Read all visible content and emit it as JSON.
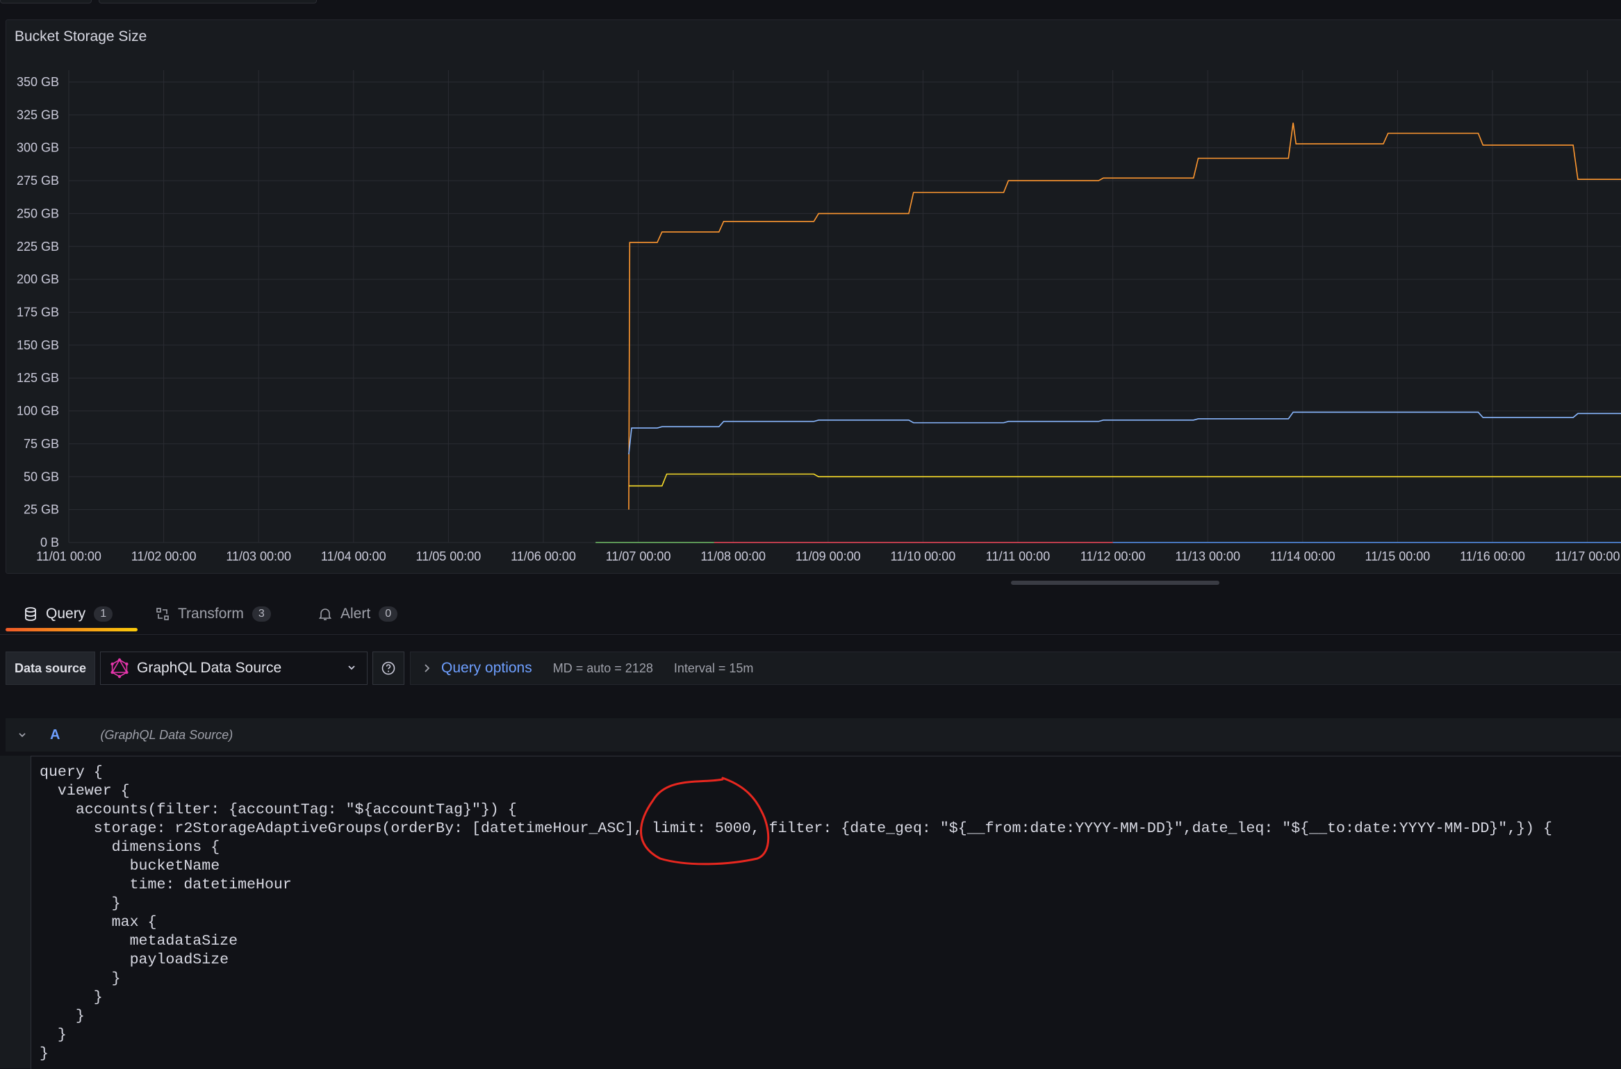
{
  "panel": {
    "title": "Bucket Storage Size"
  },
  "chart_data": {
    "type": "line",
    "title": "Bucket Storage Size",
    "y_ticks": [
      "0 B",
      "25 GB",
      "50 GB",
      "75 GB",
      "100 GB",
      "125 GB",
      "150 GB",
      "175 GB",
      "200 GB",
      "225 GB",
      "250 GB",
      "275 GB",
      "300 GB",
      "325 GB",
      "350 GB"
    ],
    "x_ticks": [
      "11/01 00:00",
      "11/02 00:00",
      "11/03 00:00",
      "11/04 00:00",
      "11/05 00:00",
      "11/06 00:00",
      "11/07 00:00",
      "11/08 00:00",
      "11/09 00:00",
      "11/10 00:00",
      "11/11 00:00",
      "11/12 00:00",
      "11/13 00:00",
      "11/14 00:00",
      "11/15 00:00",
      "11/16 00:00",
      "11/17 00:00"
    ],
    "ylim": [
      0,
      350
    ],
    "grid": true,
    "series": [
      {
        "color": "#ff9830",
        "points": [
          [
            5.9,
            25
          ],
          [
            5.91,
            228
          ],
          [
            6.2,
            228
          ],
          [
            6.25,
            236
          ],
          [
            6.85,
            236
          ],
          [
            6.9,
            244
          ],
          [
            7.85,
            244
          ],
          [
            7.9,
            250
          ],
          [
            8.85,
            250
          ],
          [
            8.9,
            266
          ],
          [
            9.85,
            266
          ],
          [
            9.9,
            275
          ],
          [
            10.85,
            275
          ],
          [
            10.9,
            277
          ],
          [
            11.85,
            277
          ],
          [
            11.9,
            292
          ],
          [
            12.85,
            292
          ],
          [
            12.9,
            319
          ],
          [
            12.93,
            303
          ],
          [
            13.85,
            303
          ],
          [
            13.9,
            311
          ],
          [
            14.85,
            311
          ],
          [
            14.9,
            302
          ],
          [
            15.85,
            302
          ],
          [
            15.9,
            276
          ],
          [
            16.5,
            276
          ]
        ]
      },
      {
        "color": "#8ab8ff",
        "points": [
          [
            5.9,
            67
          ],
          [
            5.93,
            87
          ],
          [
            6.2,
            87
          ],
          [
            6.25,
            88
          ],
          [
            6.85,
            88
          ],
          [
            6.9,
            92
          ],
          [
            7.85,
            92
          ],
          [
            7.9,
            93
          ],
          [
            8.85,
            93
          ],
          [
            8.9,
            91
          ],
          [
            9.85,
            91
          ],
          [
            9.9,
            92
          ],
          [
            10.85,
            92
          ],
          [
            10.9,
            93
          ],
          [
            11.85,
            93
          ],
          [
            11.9,
            94
          ],
          [
            12.85,
            94
          ],
          [
            12.9,
            99
          ],
          [
            13.85,
            99
          ],
          [
            13.9,
            99
          ],
          [
            14.85,
            99
          ],
          [
            14.9,
            95
          ],
          [
            15.85,
            95
          ],
          [
            15.9,
            98
          ],
          [
            16.5,
            98
          ]
        ]
      },
      {
        "color": "#fade2a",
        "points": [
          [
            5.9,
            43
          ],
          [
            6.25,
            43
          ],
          [
            6.3,
            52
          ],
          [
            7.85,
            52
          ],
          [
            7.9,
            50
          ],
          [
            8.85,
            50
          ],
          [
            8.9,
            50
          ],
          [
            16.5,
            50
          ]
        ]
      },
      {
        "color": "#73bf69",
        "points": [
          [
            5.55,
            0
          ],
          [
            6.8,
            0
          ]
        ]
      },
      {
        "color": "#f2495c",
        "points": [
          [
            6.8,
            0
          ],
          [
            11.0,
            0
          ]
        ]
      },
      {
        "color": "#5794f2",
        "points": [
          [
            11.0,
            0
          ],
          [
            16.5,
            0
          ]
        ]
      }
    ]
  },
  "tabs": [
    {
      "label": "Query",
      "count": "1"
    },
    {
      "label": "Transform",
      "count": "3"
    },
    {
      "label": "Alert",
      "count": "0"
    }
  ],
  "datasource": {
    "label": "Data source",
    "selected": "GraphQL Data Source",
    "query_options_label": "Query options",
    "md": "MD = auto = 2128",
    "interval": "Interval = 15m"
  },
  "query": {
    "ref": "A",
    "source": "(GraphQL Data Source)",
    "code": "query {\n  viewer {\n    accounts(filter: {accountTag: \"${accountTag}\"}) {\n      storage: r2StorageAdaptiveGroups(orderBy: [datetimeHour_ASC], limit: 5000, filter: {date_geq: \"${__from:date:YYYY-MM-DD}\",date_leq: \"${__to:date:YYYY-MM-DD}\",}) {\n        dimensions {\n          bucketName\n          time: datetimeHour\n        }\n        max {\n          metadataSize\n          payloadSize\n        }\n      }\n    }\n  }\n}"
  }
}
